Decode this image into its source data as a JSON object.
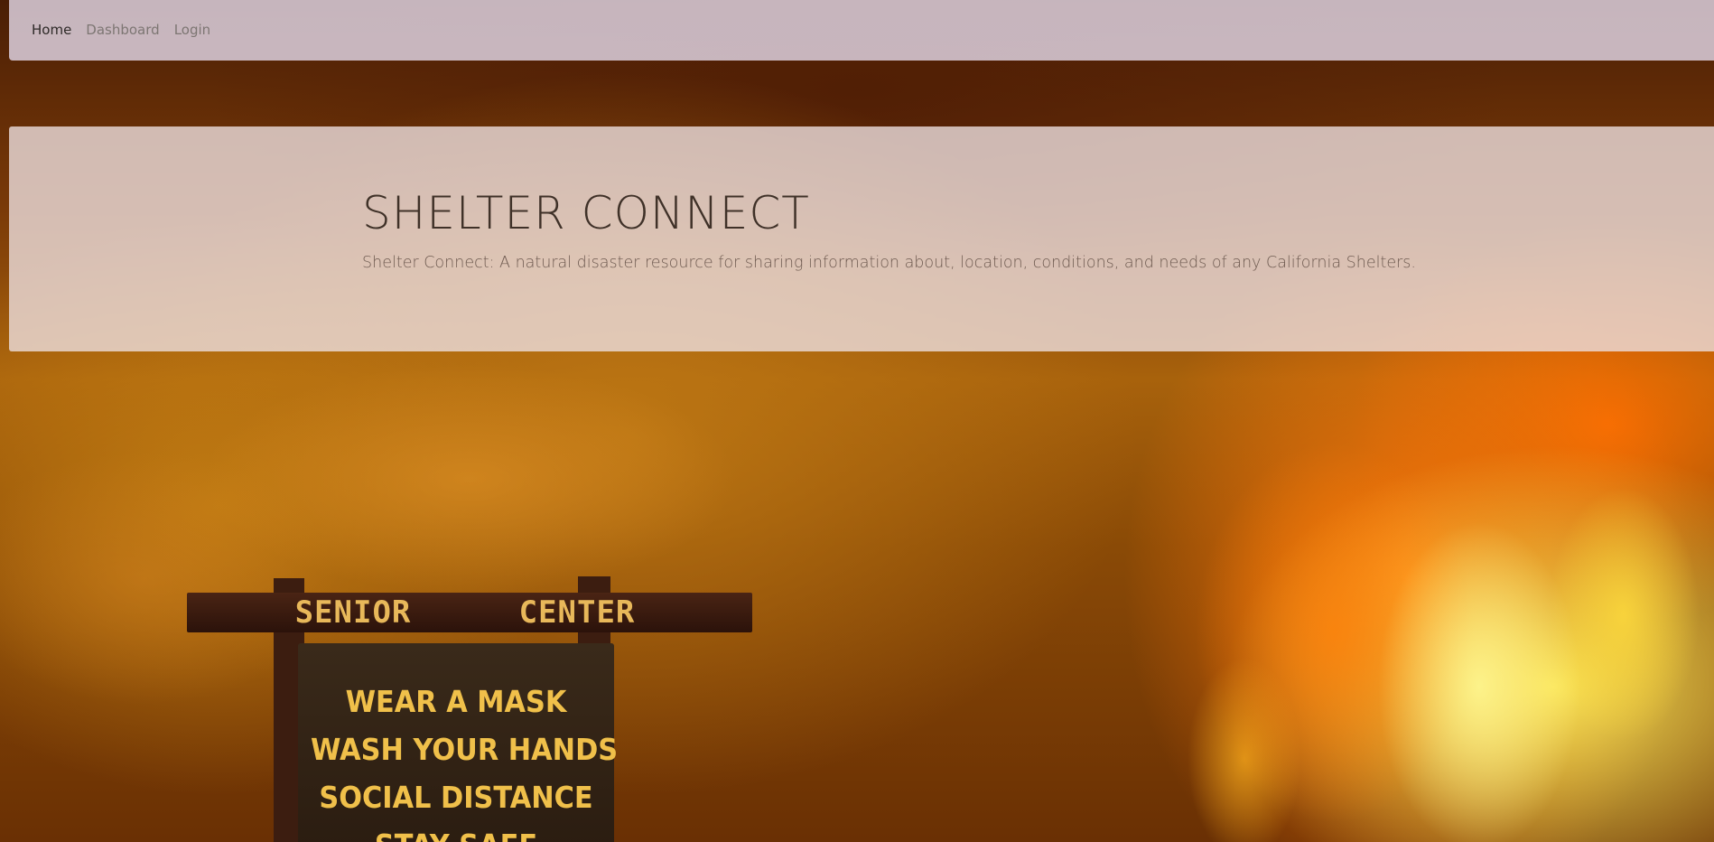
{
  "nav": {
    "items": [
      {
        "label": "Home",
        "active": true
      },
      {
        "label": "Dashboard",
        "active": false
      },
      {
        "label": "Login",
        "active": false
      }
    ]
  },
  "hero": {
    "title": "SHELTER CONNECT",
    "subtitle": "Shelter Connect: A natural disaster resource for sharing information about, location, conditions, and needs of any California Shelters."
  },
  "background_sign": {
    "top_left": "SENIOR",
    "top_right": "CENTER",
    "lines": [
      "WEAR A MASK",
      "WASH YOUR HANDS",
      "SOCIAL DISTANCE",
      "STAY SAFE"
    ]
  },
  "colors": {
    "navbar_bg": "#e2d7e6",
    "hero_bg": "#ecdede",
    "title_text": "#3f3128",
    "nav_active": "#2e2a28",
    "nav_inactive": "#7d7673",
    "sign_text": "#f0c04a"
  }
}
